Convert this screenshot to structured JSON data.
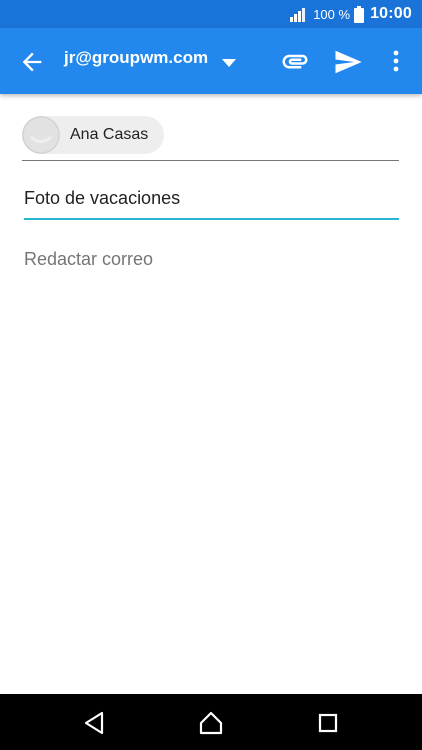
{
  "status_bar": {
    "battery_percent": "100 %",
    "time": "10:00",
    "signal_icon": "signal-icon",
    "battery_icon": "battery-icon"
  },
  "app_bar": {
    "account": "jr@groupwm.com",
    "back_icon": "arrow-back-icon",
    "dropdown_icon": "dropdown-arrow-icon",
    "attach_icon": "paperclip-icon",
    "send_icon": "send-icon",
    "more_icon": "more-vert-icon",
    "color": "#2288ee"
  },
  "compose": {
    "recipient_chip": {
      "label": "Ana Casas",
      "avatar_icon": "avatar-icon"
    },
    "subject": "Foto de vacaciones",
    "body_placeholder": "Redactar correo",
    "accent_color": "#29b6d4"
  },
  "nav_bar": {
    "back_icon": "nav-back-icon",
    "home_icon": "nav-home-icon",
    "recent_icon": "nav-recent-icon"
  }
}
